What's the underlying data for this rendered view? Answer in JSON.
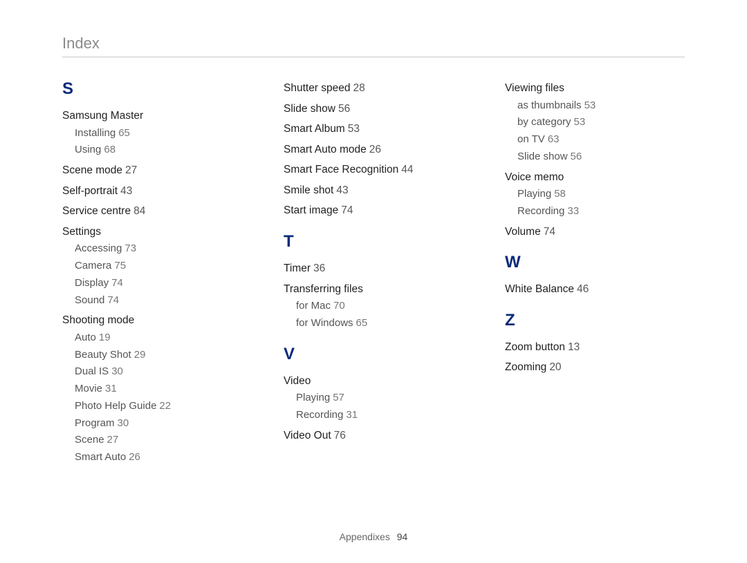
{
  "header": {
    "title": "Index"
  },
  "footer": {
    "section": "Appendixes",
    "page": "94"
  },
  "S": {
    "letter": "S",
    "samsung_master": "Samsung Master",
    "samsung_master_sub": {
      "installing": {
        "label": "Installing",
        "page": "65"
      },
      "using": {
        "label": "Using",
        "page": "68"
      }
    },
    "scene_mode": {
      "label": "Scene mode",
      "page": "27"
    },
    "self_portrait": {
      "label": "Self-portrait",
      "page": "43"
    },
    "service_centre": {
      "label": "Service centre",
      "page": "84"
    },
    "settings": "Settings",
    "settings_sub": {
      "accessing": {
        "label": "Accessing",
        "page": "73"
      },
      "camera": {
        "label": "Camera",
        "page": "75"
      },
      "display": {
        "label": "Display",
        "page": "74"
      },
      "sound": {
        "label": "Sound",
        "page": "74"
      }
    },
    "shooting_mode": "Shooting mode",
    "shooting_mode_sub": {
      "auto": {
        "label": "Auto",
        "page": "19"
      },
      "beauty": {
        "label": "Beauty Shot",
        "page": "29"
      },
      "dual": {
        "label": "Dual IS",
        "page": "30"
      },
      "movie": {
        "label": "Movie",
        "page": "31"
      },
      "photo_help": {
        "label": "Photo Help Guide",
        "page": "22"
      },
      "program": {
        "label": "Program",
        "page": "30"
      },
      "scene": {
        "label": "Scene",
        "page": "27"
      },
      "smart_auto": {
        "label": "Smart Auto",
        "page": "26"
      }
    },
    "shutter_speed": {
      "label": "Shutter speed",
      "page": "28"
    },
    "slide_show": {
      "label": "Slide show",
      "page": "56"
    },
    "smart_album": {
      "label": "Smart Album",
      "page": "53"
    },
    "smart_auto_mode": {
      "label": "Smart Auto mode",
      "page": "26"
    },
    "smart_face": {
      "label": "Smart Face Recognition",
      "page": "44"
    },
    "smile_shot": {
      "label": "Smile shot",
      "page": "43"
    },
    "start_image": {
      "label": "Start image",
      "page": "74"
    }
  },
  "T": {
    "letter": "T",
    "timer": {
      "label": "Timer",
      "page": "36"
    },
    "transferring": "Transferring files",
    "transferring_sub": {
      "mac": {
        "label": "for Mac",
        "page": "70"
      },
      "win": {
        "label": "for Windows",
        "page": "65"
      }
    }
  },
  "V": {
    "letter": "V",
    "video": "Video",
    "video_sub": {
      "playing": {
        "label": "Playing",
        "page": "57"
      },
      "recording": {
        "label": "Recording",
        "page": "31"
      }
    },
    "video_out": {
      "label": "Video Out",
      "page": "76"
    },
    "viewing_files": "Viewing files",
    "viewing_sub": {
      "thumbnails": {
        "label": "as thumbnails",
        "page": "53"
      },
      "category": {
        "label": "by category",
        "page": "53"
      },
      "tv": {
        "label": "on TV",
        "page": "63"
      },
      "slide": {
        "label": "Slide show",
        "page": "56"
      }
    },
    "voice_memo": "Voice memo",
    "voice_sub": {
      "playing": {
        "label": "Playing",
        "page": "58"
      },
      "recording": {
        "label": "Recording",
        "page": "33"
      }
    },
    "volume": {
      "label": "Volume",
      "page": "74"
    }
  },
  "W": {
    "letter": "W",
    "white_balance": {
      "label": "White Balance",
      "page": "46"
    }
  },
  "Z": {
    "letter": "Z",
    "zoom_button": {
      "label": "Zoom button",
      "page": "13"
    },
    "zooming": {
      "label": "Zooming",
      "page": "20"
    }
  }
}
